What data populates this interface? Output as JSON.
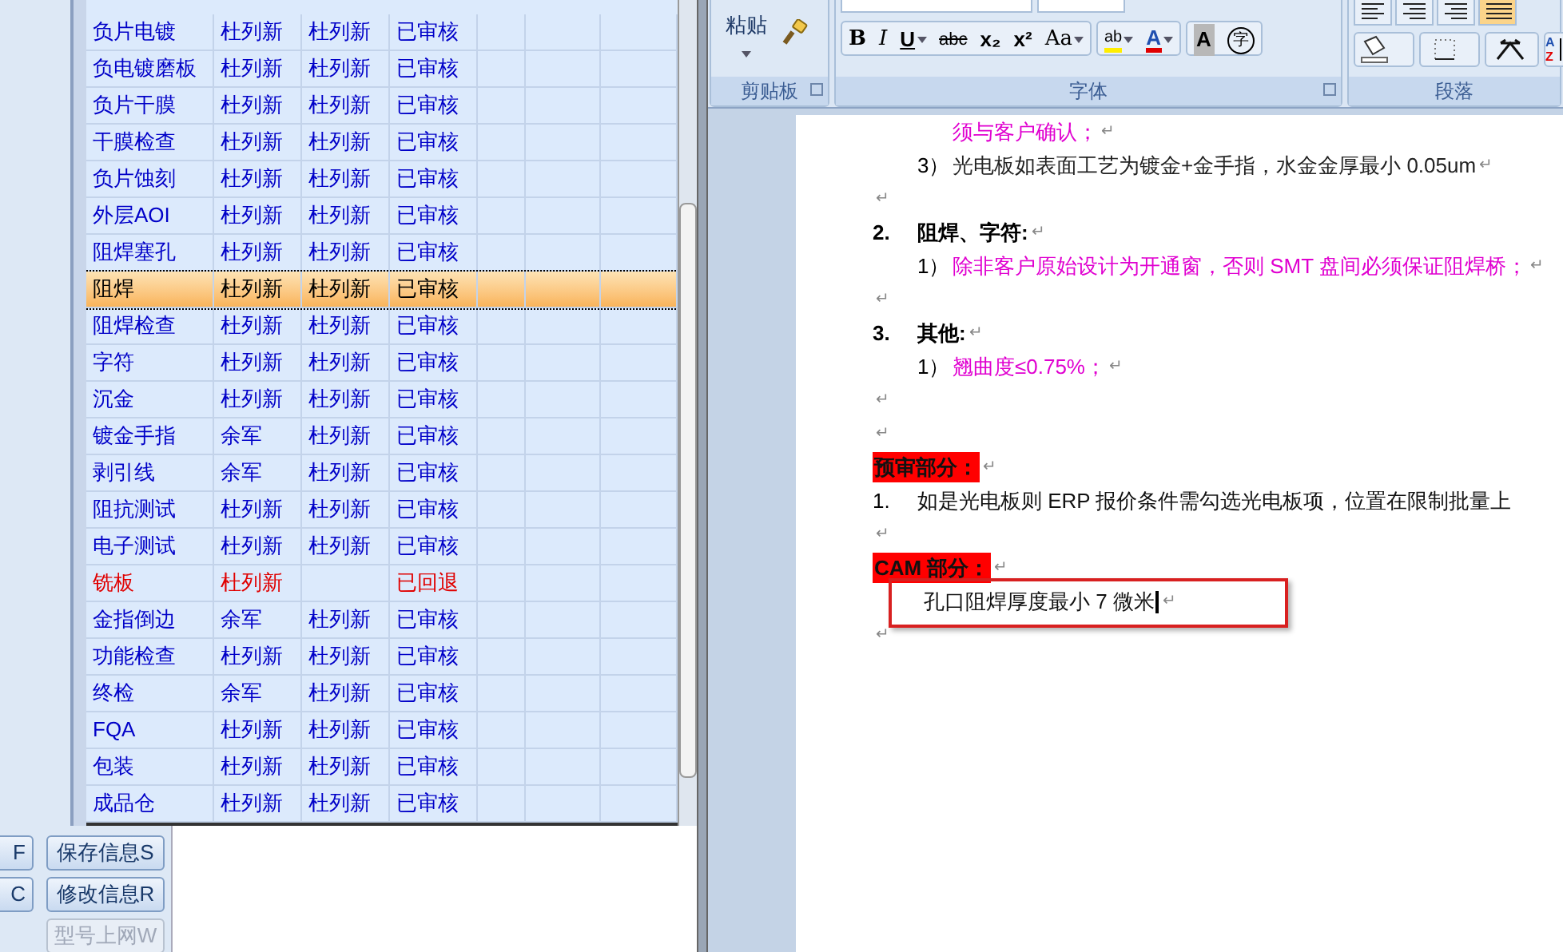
{
  "table": {
    "rows": [
      {
        "cells": [
          "负片电镀",
          "杜列新",
          "杜列新",
          "已审核"
        ],
        "selected": false,
        "returned": false
      },
      {
        "cells": [
          "负电镀磨板",
          "杜列新",
          "杜列新",
          "已审核"
        ],
        "selected": false,
        "returned": false
      },
      {
        "cells": [
          "负片干膜",
          "杜列新",
          "杜列新",
          "已审核"
        ],
        "selected": false,
        "returned": false
      },
      {
        "cells": [
          "干膜检查",
          "杜列新",
          "杜列新",
          "已审核"
        ],
        "selected": false,
        "returned": false
      },
      {
        "cells": [
          "负片蚀刻",
          "杜列新",
          "杜列新",
          "已审核"
        ],
        "selected": false,
        "returned": false
      },
      {
        "cells": [
          "外层AOI",
          "杜列新",
          "杜列新",
          "已审核"
        ],
        "selected": false,
        "returned": false
      },
      {
        "cells": [
          "阻焊塞孔",
          "杜列新",
          "杜列新",
          "已审核"
        ],
        "selected": false,
        "returned": false
      },
      {
        "cells": [
          "阻焊",
          "杜列新",
          "杜列新",
          "已审核"
        ],
        "selected": true,
        "returned": false
      },
      {
        "cells": [
          "阻焊检查",
          "杜列新",
          "杜列新",
          "已审核"
        ],
        "selected": false,
        "returned": false
      },
      {
        "cells": [
          "字符",
          "杜列新",
          "杜列新",
          "已审核"
        ],
        "selected": false,
        "returned": false
      },
      {
        "cells": [
          "沉金",
          "杜列新",
          "杜列新",
          "已审核"
        ],
        "selected": false,
        "returned": false
      },
      {
        "cells": [
          "镀金手指",
          "余军",
          "杜列新",
          "已审核"
        ],
        "selected": false,
        "returned": false
      },
      {
        "cells": [
          "剥引线",
          "余军",
          "杜列新",
          "已审核"
        ],
        "selected": false,
        "returned": false
      },
      {
        "cells": [
          "阻抗测试",
          "杜列新",
          "杜列新",
          "已审核"
        ],
        "selected": false,
        "returned": false
      },
      {
        "cells": [
          "电子测试",
          "杜列新",
          "杜列新",
          "已审核"
        ],
        "selected": false,
        "returned": false
      },
      {
        "cells": [
          "铣板",
          "杜列新",
          "",
          "已回退"
        ],
        "selected": false,
        "returned": true
      },
      {
        "cells": [
          "金指倒边",
          "余军",
          "杜列新",
          "已审核"
        ],
        "selected": false,
        "returned": false
      },
      {
        "cells": [
          "功能检查",
          "杜列新",
          "杜列新",
          "已审核"
        ],
        "selected": false,
        "returned": false
      },
      {
        "cells": [
          "终检",
          "余军",
          "杜列新",
          "已审核"
        ],
        "selected": false,
        "returned": false
      },
      {
        "cells": [
          "FQA",
          "杜列新",
          "杜列新",
          "已审核"
        ],
        "selected": false,
        "returned": false
      },
      {
        "cells": [
          "包装",
          "杜列新",
          "杜列新",
          "已审核"
        ],
        "selected": false,
        "returned": false
      },
      {
        "cells": [
          "成品仓",
          "杜列新",
          "杜列新",
          "已审核"
        ],
        "selected": false,
        "returned": false
      }
    ]
  },
  "buttons_left": [
    {
      "label": "F",
      "disabled": false
    },
    {
      "label": "C",
      "disabled": false
    }
  ],
  "buttons": [
    {
      "label": "保存信息S",
      "disabled": false
    },
    {
      "label": "修改信息R",
      "disabled": false
    },
    {
      "label": "型号上网W",
      "disabled": true
    }
  ],
  "ribbon": {
    "groups": [
      {
        "label": "剪贴板"
      },
      {
        "label": "字体"
      },
      {
        "label": "段落"
      }
    ],
    "paste": "粘贴",
    "font_buttons": [
      {
        "kind": "bold",
        "label": "B"
      },
      {
        "kind": "italic",
        "label": "I"
      },
      {
        "kind": "underline",
        "label": "U"
      },
      {
        "kind": "strike",
        "label": "abc"
      },
      {
        "kind": "sub",
        "label": "x₂"
      },
      {
        "kind": "sup",
        "label": "x²"
      },
      {
        "kind": "case",
        "label": "Aa"
      },
      {
        "kind": "highlight",
        "label": "ab"
      },
      {
        "kind": "color",
        "label": "A"
      },
      {
        "kind": "shade",
        "label": "A"
      },
      {
        "kind": "enclose",
        "label": "字"
      }
    ],
    "sort_labels": [
      "A",
      "Z"
    ]
  },
  "document": {
    "mark": "↵",
    "lines": [
      {
        "kind": "text",
        "text": "须与客户确认；",
        "emphasis": true
      },
      {
        "kind": "text",
        "number": "3）",
        "text": "光电板如表面工艺为镀金+金手指，水金金厚最小 0.05um",
        "emphasis": false
      },
      {
        "kind": "blank"
      },
      {
        "kind": "heading",
        "number": "2.",
        "text": "阻焊、字符:"
      },
      {
        "kind": "text",
        "number": "1）",
        "text": "除非客户原始设计为开通窗，否则 SMT 盘间必须保证阻焊桥；",
        "emphasis": true
      },
      {
        "kind": "blank"
      },
      {
        "kind": "heading",
        "number": "3.",
        "text": "其他:"
      },
      {
        "kind": "text",
        "number": "1）",
        "text": "翘曲度≤0.75%；",
        "emphasis": true
      },
      {
        "kind": "blank"
      },
      {
        "kind": "blank"
      },
      {
        "kind": "section",
        "text": "预审部分："
      },
      {
        "kind": "numbered",
        "number": "1.",
        "text": "如是光电板则 ERP 报价条件需勾选光电板项，位置在限制批量上"
      },
      {
        "kind": "blank"
      },
      {
        "kind": "section",
        "text": "CAM 部分："
      },
      {
        "kind": "boxed",
        "text": "孔口阻焊厚度最小 7 微米"
      },
      {
        "kind": "blank"
      }
    ]
  }
}
